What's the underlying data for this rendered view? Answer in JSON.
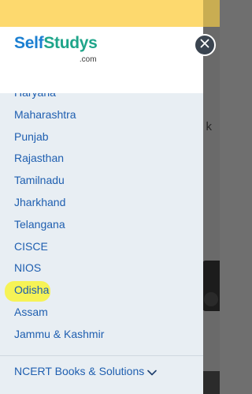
{
  "brand": {
    "logo_self": "Self",
    "logo_studys": "Studys",
    "logo_domain": ".com"
  },
  "menu": {
    "items": [
      {
        "label": "Haryana"
      },
      {
        "label": "Maharashtra"
      },
      {
        "label": "Punjab"
      },
      {
        "label": "Rajasthan"
      },
      {
        "label": "Tamilnadu"
      },
      {
        "label": "Jharkhand"
      },
      {
        "label": "Telangana"
      },
      {
        "label": "CISCE"
      },
      {
        "label": "NIOS"
      },
      {
        "label": "Odisha",
        "highlighted": true
      },
      {
        "label": "Assam"
      },
      {
        "label": "Jammu & Kashmir"
      }
    ],
    "highlight_color": "#f7f24d"
  },
  "footer": {
    "link_label": "NCERT Books & Solutions"
  },
  "background": {
    "letter": "k"
  },
  "colors": {
    "link": "#1f5fb0",
    "drawer_bg": "#e8eef3",
    "top_band": "#fdd96e",
    "close_button": "#3a4450"
  },
  "icons": {
    "close": "close-icon",
    "footer_chevron": "chevron-down-icon"
  }
}
